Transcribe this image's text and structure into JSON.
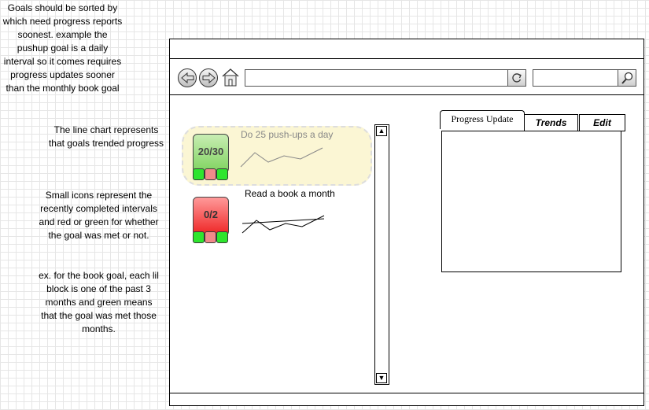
{
  "notes": [
    "Goals should be sorted by which need progress reports soonest. example the pushup goal is a daily interval so it comes requires progress updates sooner than the monthly book goal",
    "The line chart represents that goals trended progress",
    "Small icons represent the recently completed intervals and red or green for whether the goal was met or not.",
    "ex. for the book goal, each lil block is one of the past 3 months and green means that the goal was met those months."
  ],
  "goals": [
    {
      "title": "Do 25 push-ups a day",
      "progress": "20/30",
      "progress_color": "#7fd35f",
      "blocks": [
        "met",
        "not-met",
        "met"
      ]
    },
    {
      "title": "Read a book a month",
      "progress": "0/2",
      "progress_color": "#ee2222",
      "blocks": [
        "met",
        "not-met",
        "met"
      ]
    }
  ],
  "tabs": [
    {
      "label": "Progress Update",
      "active": true
    },
    {
      "label": "Trends",
      "active": false
    },
    {
      "label": "Edit",
      "active": false
    }
  ],
  "icons": {
    "back": "back-arrow-icon",
    "forward": "forward-arrow-icon",
    "home": "home-icon",
    "go": "refresh-icon",
    "search": "magnifier-icon",
    "scroll_up": "up-triangle-icon",
    "scroll_down": "down-triangle-icon"
  },
  "colors": {
    "met": "#2ee52e",
    "not_met": "#f08a8a",
    "highlight": "#fbf6d4"
  }
}
